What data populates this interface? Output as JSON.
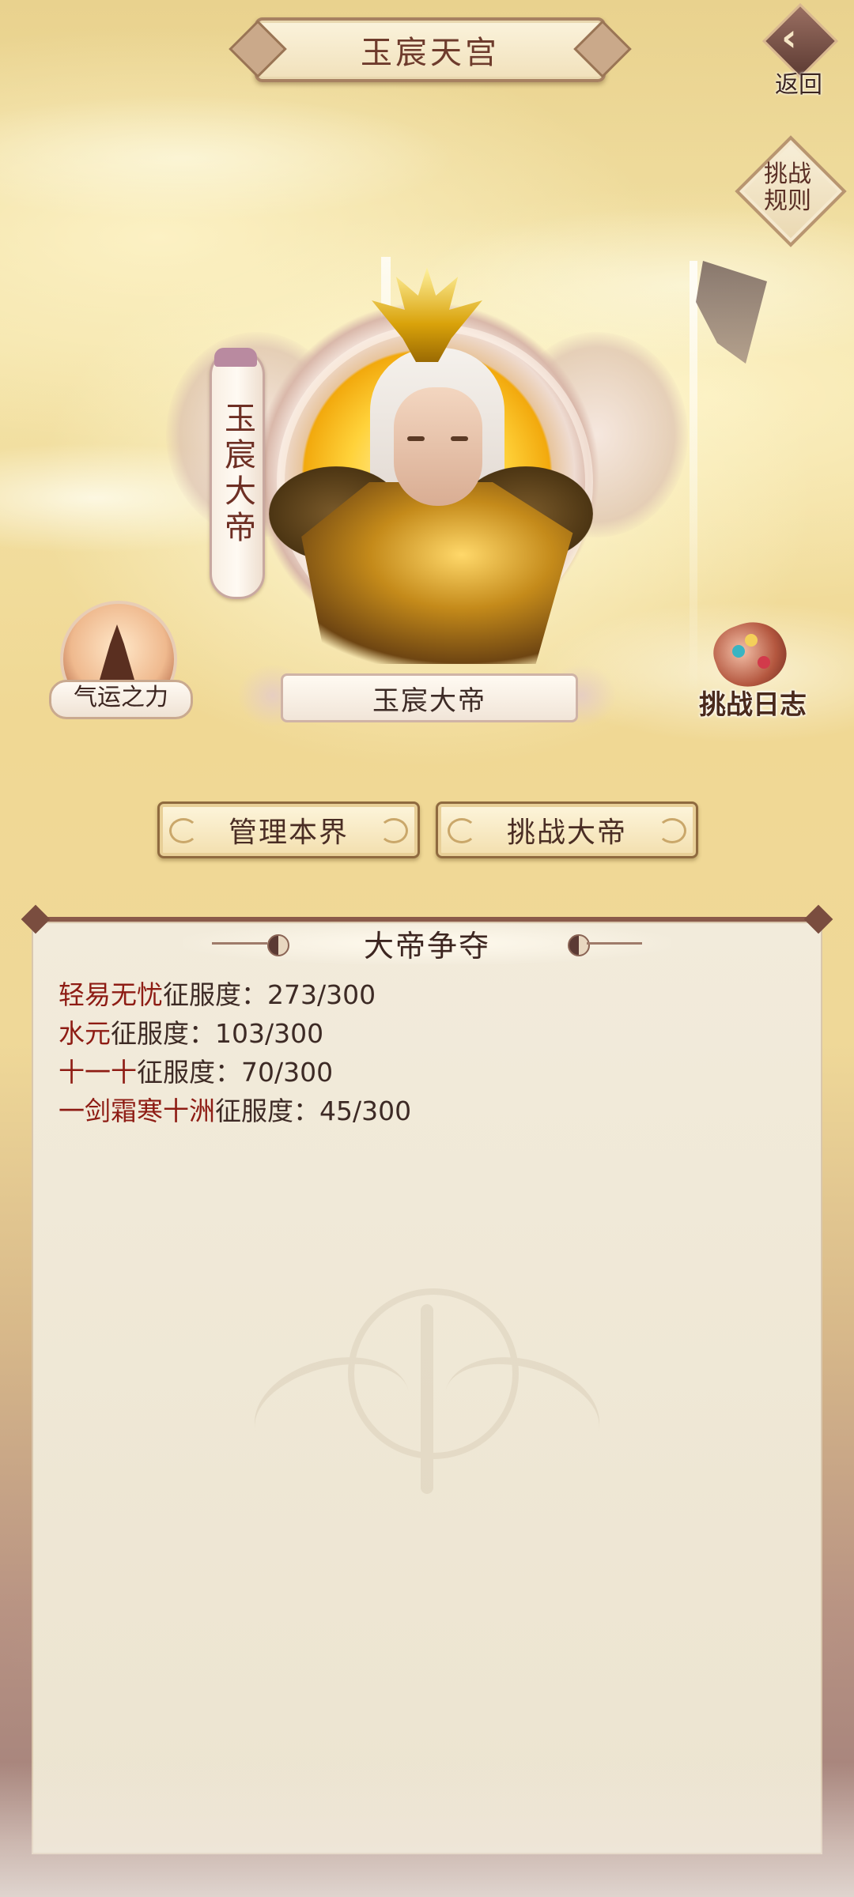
{
  "header": {
    "title": "玉宸天宫",
    "back_label": "返回",
    "back_icon": "back-arrow-icon"
  },
  "rules_button": {
    "label": "挑战规则"
  },
  "hero": {
    "vertical_name": "玉宸大帝",
    "name_plate": "玉宸大帝"
  },
  "side_buttons": {
    "fortune": {
      "label": "气运之力",
      "icon": "fortune-figure-icon"
    },
    "challenge_log": {
      "label": "挑战日志",
      "icon": "scroll-icon"
    }
  },
  "actions": {
    "manage": "管理本界",
    "challenge": "挑战大帝"
  },
  "panel": {
    "title": "大帝争夺",
    "standings": [
      {
        "player": "轻易无忧",
        "label": "征服度：",
        "value": "273/300"
      },
      {
        "player": "水元",
        "label": "征服度：",
        "value": "103/300"
      },
      {
        "player": "十一十",
        "label": "征服度：",
        "value": "70/300"
      },
      {
        "player": "一剑霜寒十洲",
        "label": "征服度：",
        "value": "45/300"
      }
    ]
  },
  "colors": {
    "player_name": "#8e1c14",
    "text_dark": "#3d2a25",
    "panel_border": "#8a5a4a",
    "gold": "#f2a90d"
  }
}
